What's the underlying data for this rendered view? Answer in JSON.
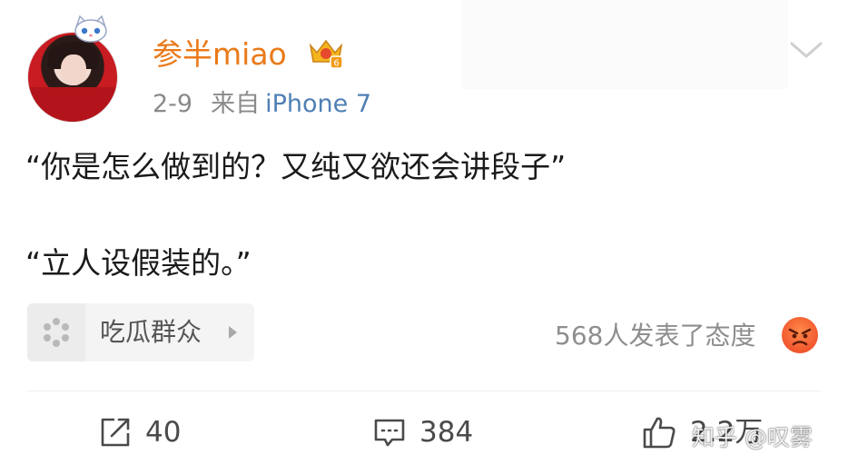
{
  "post": {
    "username": "参半miao",
    "date": "2-9",
    "source_prefix": "来自",
    "device": "iPhone 7",
    "text_line1": "“你是怎么做到的？又纯又欲还会讲段子”",
    "text_line2": "“立人设假装的。”"
  },
  "topic": {
    "label": "吃瓜群众"
  },
  "reactions": {
    "text": "568人发表了态度"
  },
  "actions": {
    "reposts": "40",
    "comments": "384",
    "likes": "2.2万"
  },
  "watermark": {
    "text": "知乎 @叹雾"
  },
  "colors": {
    "username": "#ea7a1a",
    "device_link": "#4f7fb5",
    "meta_gray": "#8a8a8a",
    "icon_gray": "#4a4a4a"
  },
  "icons": {
    "vip": "crown-badge-icon",
    "more": "chevron-down-icon",
    "topic": "flower-icon",
    "topic_arrow": "triangle-right-icon",
    "reaction": "angry-face-icon",
    "repost": "share-box-icon",
    "comment": "speech-bubble-icon",
    "like": "thumbs-up-icon"
  }
}
